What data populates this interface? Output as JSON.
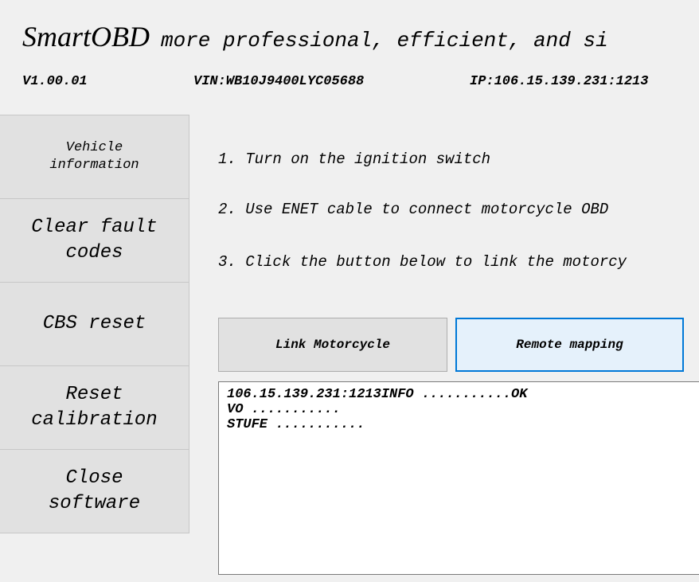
{
  "header": {
    "brand": "SmartOBD",
    "tagline": "more professional, efficient, and si",
    "version": "V1.00.01",
    "vin": "VIN:WB10J9400LYC05688",
    "ip": "IP:106.15.139.231:1213"
  },
  "sidebar": {
    "items": [
      {
        "label": "Vehicle\ninformation"
      },
      {
        "label": "Clear fault\ncodes"
      },
      {
        "label": "CBS reset"
      },
      {
        "label": "Reset\ncalibration"
      },
      {
        "label": "Close\nsoftware"
      }
    ]
  },
  "instructions": {
    "steps": [
      "1. Turn on the ignition switch",
      "2. Use ENET cable to connect motorcycle OBD",
      "3. Click the button below to link the motorcy"
    ]
  },
  "actions": {
    "link_label": "Link Motorcycle",
    "remote_label": "Remote mapping"
  },
  "log": {
    "lines": [
      "106.15.139.231:1213INFO ...........OK",
      "VO ...........",
      "STUFE ..........."
    ]
  }
}
